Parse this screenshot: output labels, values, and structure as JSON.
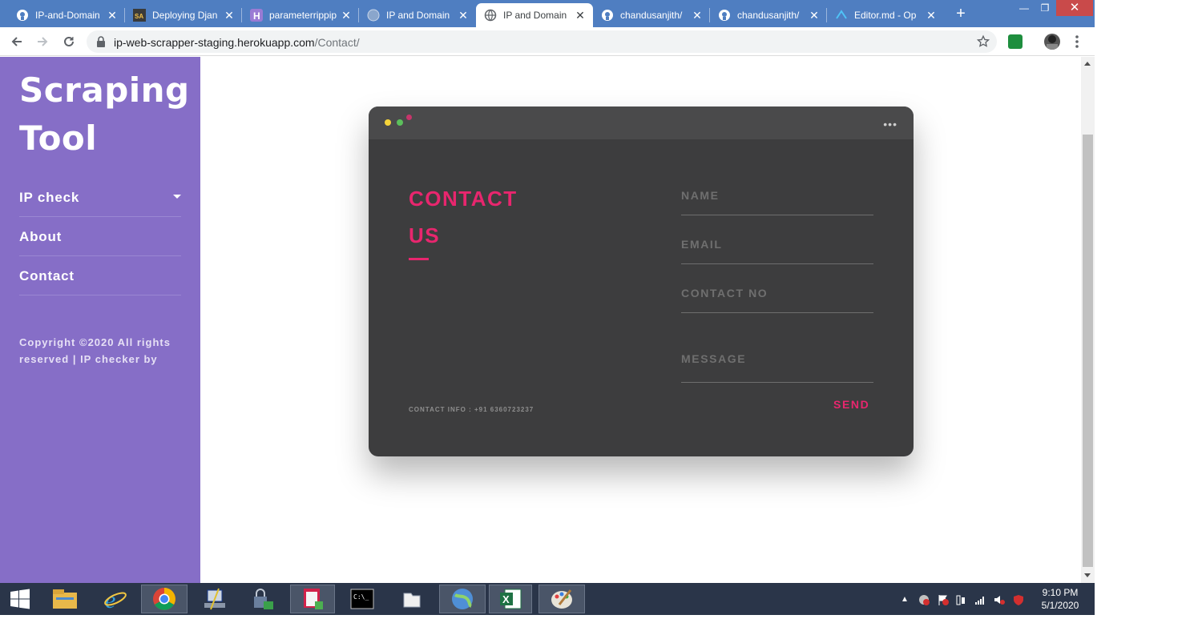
{
  "browser": {
    "tabs": [
      {
        "title": "IP-and-Domain",
        "favicon": "github-icon",
        "active": false
      },
      {
        "title": "Deploying Djan",
        "favicon": "sa-icon",
        "active": false
      },
      {
        "title": "parameterrippip",
        "favicon": "heroku-icon",
        "active": false
      },
      {
        "title": "IP and Domain",
        "favicon": "globe-icon",
        "active": false
      },
      {
        "title": "IP and Domain",
        "favicon": "globe-icon",
        "active": true
      },
      {
        "title": "chandusanjith/",
        "favicon": "github-icon",
        "active": false
      },
      {
        "title": "chandusanjith/",
        "favicon": "github-icon",
        "active": false
      },
      {
        "title": "Editor.md - Op",
        "favicon": "editor-icon",
        "active": false
      }
    ],
    "new_tab_label": "+",
    "address": {
      "host": "ip-web-scrapper-staging.herokuapp.com",
      "path": "/Contact/"
    }
  },
  "sidebar": {
    "brand_line1": "Scraping",
    "brand_line2": "Tool",
    "items": [
      {
        "label": "IP check",
        "has_dropdown": true
      },
      {
        "label": "About"
      },
      {
        "label": "Contact"
      }
    ],
    "copyright": "Copyright ©2020 All rights reserved | IP checker by"
  },
  "contact": {
    "heading_line1": "CONTACT",
    "heading_line2": "US",
    "info": "CONTACT INFO : +91 6360723237",
    "fields": {
      "name_placeholder": "NAME",
      "email_placeholder": "EMAIL",
      "contact_no_placeholder": "CONTACT NO",
      "message_placeholder": "MESSAGE"
    },
    "send_label": "SEND",
    "window_dots": [
      "#f5d43a",
      "#5cc05c",
      "#c7356b"
    ]
  },
  "taskbar": {
    "apps": [
      "windows-start-icon",
      "file-explorer-icon",
      "internet-explorer-icon",
      "chrome-icon",
      "network-tool-icon",
      "security-tool-icon",
      "notepad-add-icon",
      "command-prompt-icon",
      "folder-icon",
      "globe-app-icon",
      "excel-icon",
      "paint-icon"
    ],
    "time": "9:10 PM",
    "date": "5/1/2020"
  },
  "colors": {
    "accent": "#e8266e",
    "sidebar": "#866ec7",
    "card": "#3d3d3e",
    "tabstrip": "#4f7ec1"
  }
}
